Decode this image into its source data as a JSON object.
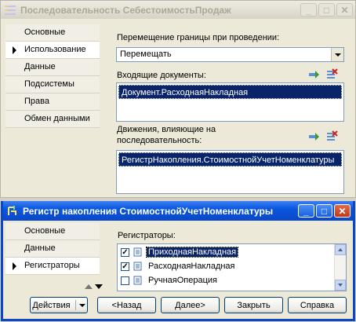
{
  "back_window": {
    "title": "Последовательность СебестоимостьПродаж",
    "tabs": [
      {
        "label": "Основные"
      },
      {
        "label": "Использование"
      },
      {
        "label": "Данные"
      },
      {
        "label": "Подсистемы"
      },
      {
        "label": "Права"
      },
      {
        "label": "Обмен данными"
      }
    ],
    "selected_tab": "Использование",
    "border_move_label": "Перемещение границы при проведении:",
    "border_move_value": "Перемещать",
    "incoming_docs_label": "Входящие  документы:",
    "incoming_docs_items": [
      "Документ.РасходнаяНакладная"
    ],
    "movements_label_line1": "Движения, влияющие на",
    "movements_label_line2": "последовательность:",
    "movements_items": [
      "РегистрНакопления.СтоимостнойУчетНоменклатуры"
    ]
  },
  "front_window": {
    "title": "Регистр накопления СтоимостнойУчетНоменклатуры",
    "tabs": [
      {
        "label": "Основные"
      },
      {
        "label": "Данные"
      },
      {
        "label": "Регистраторы"
      }
    ],
    "selected_tab": "Регистраторы",
    "registrars_label": "Регистраторы:",
    "registrars": [
      {
        "label": "ПриходнаяНакладная",
        "checked": true,
        "highlighted": true
      },
      {
        "label": "РасходнаяНакладная",
        "checked": true,
        "highlighted": false
      },
      {
        "label": "РучнаяОперация",
        "checked": false,
        "highlighted": false
      }
    ],
    "buttons": {
      "actions": "Действия",
      "back": "<Назад",
      "next": "Далее>",
      "close": "Закрыть",
      "help": "Справка"
    }
  },
  "colors": {
    "active_title": "#0a57de",
    "selection": "#0a246a",
    "inactive_title_text": "#aca899"
  }
}
